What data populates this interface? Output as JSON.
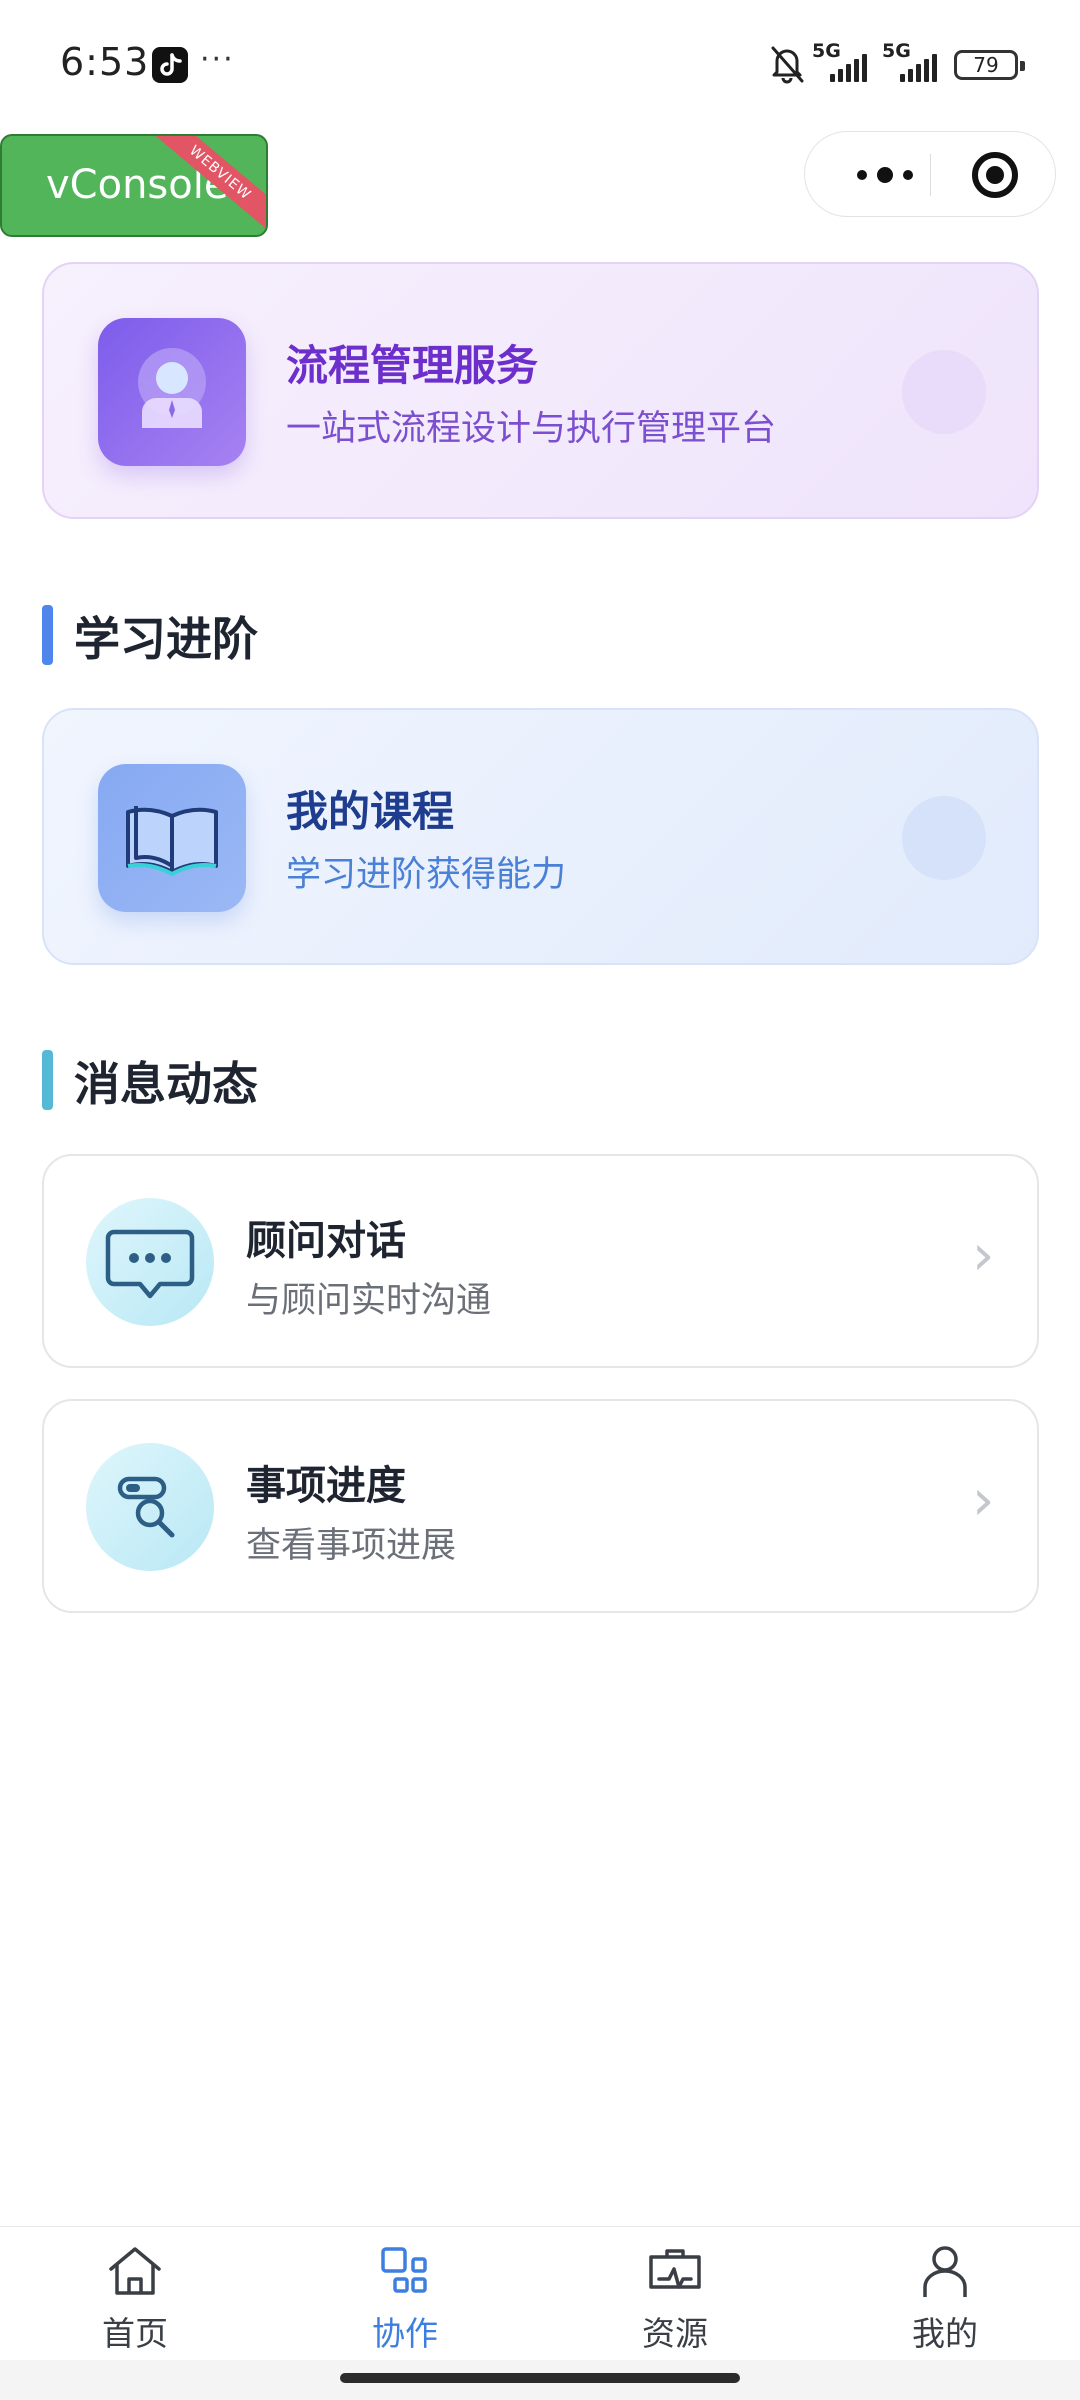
{
  "status_bar": {
    "time": "6:53",
    "more": "···",
    "signal1_label": "5G",
    "signal2_label": "5G",
    "battery": "79"
  },
  "vconsole": {
    "label": "vConsole",
    "ribbon": "WEBVIEW"
  },
  "process_card": {
    "title": "流程管理服务",
    "subtitle": "一站式流程设计与执行管理平台"
  },
  "sections": {
    "learning": "学习进阶",
    "messages": "消息动态"
  },
  "course_card": {
    "title": "我的课程",
    "subtitle": "学习进阶获得能力"
  },
  "message_items": [
    {
      "title": "顾问对话",
      "subtitle": "与顾问实时沟通",
      "icon": "chat-bubble-icon"
    },
    {
      "title": "事项进度",
      "subtitle": "查看事项进展",
      "icon": "search-progress-icon"
    }
  ],
  "chevron": "›",
  "tabs": [
    {
      "label": "首页",
      "icon": "home-icon",
      "active": false
    },
    {
      "label": "协作",
      "icon": "grid-icon",
      "active": true
    },
    {
      "label": "资源",
      "icon": "briefcase-pulse-icon",
      "active": false
    },
    {
      "label": "我的",
      "icon": "person-icon",
      "active": false
    }
  ],
  "colors": {
    "accent_blue": "#3d7fe0",
    "purple_title": "#6c2fcc",
    "learning_bar": "#4f86ec",
    "messages_bar": "#55b8d4",
    "vconsole_green": "#52b55a"
  }
}
